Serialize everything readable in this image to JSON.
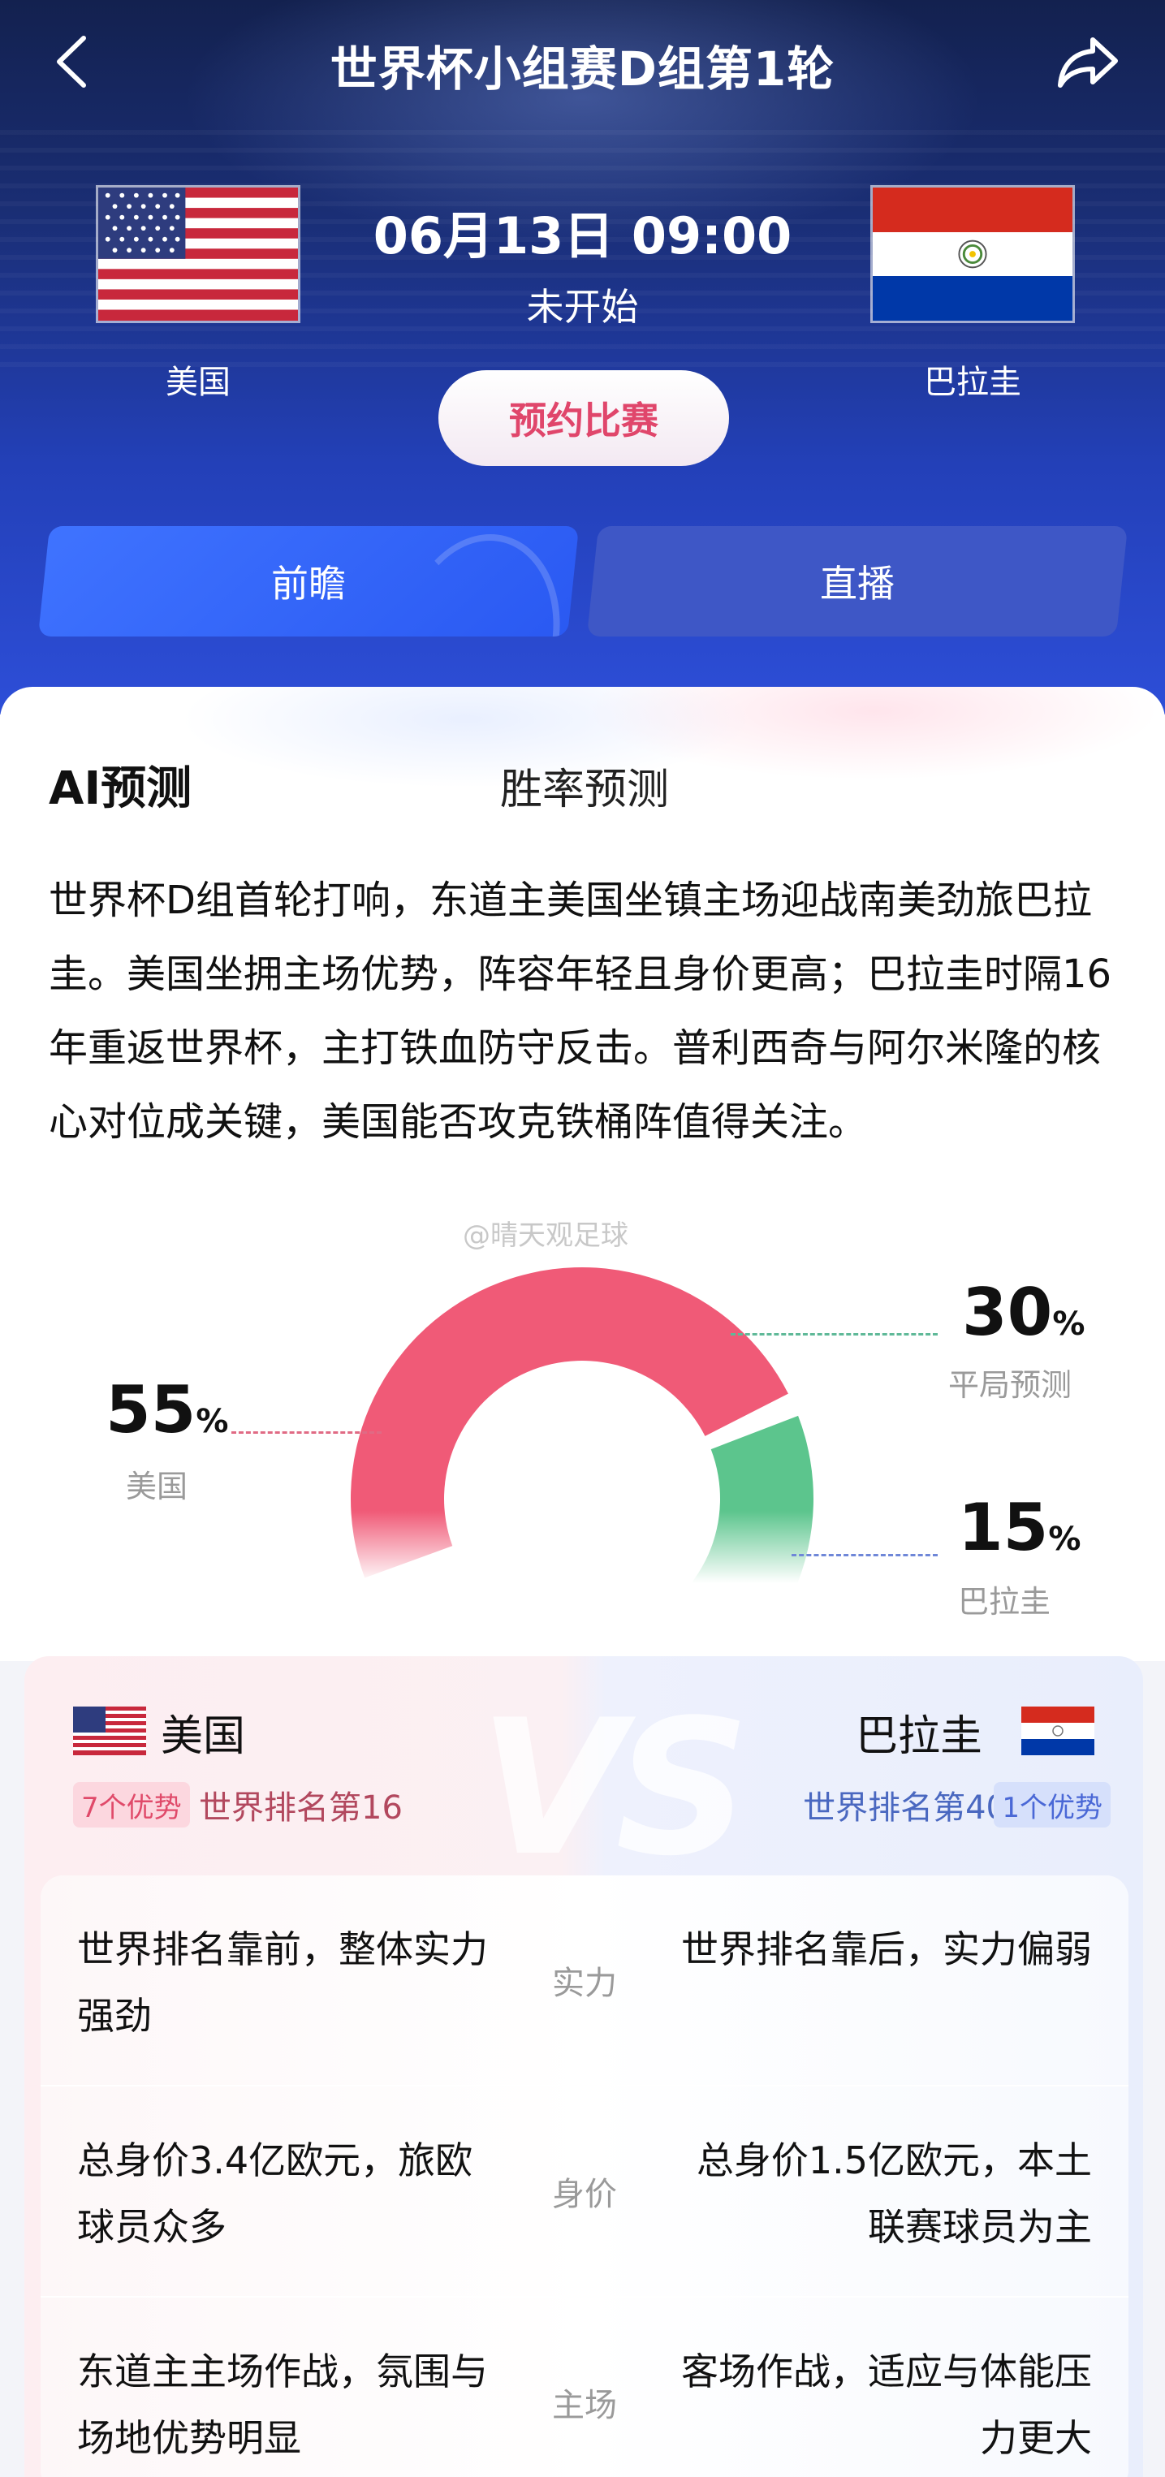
{
  "header": {
    "title": "世界杯小组赛D组第1轮",
    "back_icon": "chevron-left-icon",
    "share_icon": "share-icon"
  },
  "match": {
    "time": "06月13日 09:00",
    "status": "未开始",
    "reserve_label": "预约比赛",
    "home_team": "美国",
    "away_team": "巴拉圭"
  },
  "tabs": [
    {
      "label": "前瞻",
      "active": true
    },
    {
      "label": "直播",
      "active": false
    }
  ],
  "ai": {
    "title": "AI预测",
    "text": "世界杯D组首轮打响，东道主美国坐镇主场迎战南美劲旅巴拉圭。美国坐拥主场优势，阵容年轻且身价更高；巴拉圭时隔16年重返世界杯，主打铁血防守反击。普利西奇与阿尔米隆的核心对位成关键，美国能否攻克铁桶阵值得关注。",
    "watermark": "@晴天观足球"
  },
  "prediction": {
    "center_label": "胜率预测",
    "home_value": "55",
    "home_label": "美国",
    "draw_value": "30",
    "draw_label": "平局预测",
    "away_value": "15",
    "away_label": "巴拉圭",
    "unit": "%"
  },
  "chart_data": {
    "type": "pie",
    "title": "胜率预测",
    "categories": [
      "美国",
      "平局预测",
      "巴拉圭"
    ],
    "values": [
      55,
      30,
      15
    ],
    "colors": [
      "#f05a77",
      "#5cc58d",
      "#3b6cf5"
    ]
  },
  "comparison": {
    "vs_text": "VS",
    "home": {
      "name": "美国",
      "advantage": "7个优势",
      "rank": "世界排名第16"
    },
    "away": {
      "name": "巴拉圭",
      "advantage": "1个优势",
      "rank": "世界排名第40"
    },
    "rows": [
      {
        "category": "实力",
        "home": "世界排名靠前，整体实力强劲",
        "away": "世界排名靠后，实力偏弱"
      },
      {
        "category": "身价",
        "home": "总身价3.4亿欧元，旅欧球员众多",
        "away": "总身价1.5亿欧元，本土联赛球员为主"
      },
      {
        "category": "主场",
        "home": "东道主主场作战，氛围与场地优势明显",
        "away": "客场作战，适应与体能压力更大"
      }
    ]
  },
  "colors": {
    "header_blue": "#2340b8",
    "accent_pink": "#e0466b",
    "home_red": "#f05a77",
    "draw_green": "#5cc58d",
    "away_blue": "#3b6cf5"
  }
}
